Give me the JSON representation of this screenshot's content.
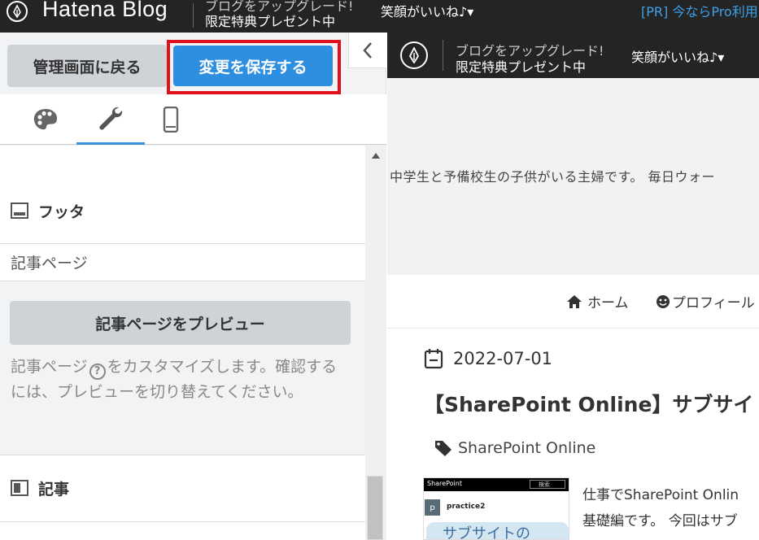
{
  "topbar": {
    "logo_text": "Hatena Blog",
    "promo_line1": "ブログをアップグレード!",
    "promo_line2": "限定特典プレゼント中",
    "user": "笑顔がいいね♪▾",
    "pr_link": "[PR] 今ならPro利用"
  },
  "panel": {
    "back_button": "管理画面に戻る",
    "save_button": "変更を保存する",
    "tabs": [
      "design",
      "customize",
      "smartphone"
    ],
    "sections": {
      "footer_label": "フッタ",
      "article_page_label": "記事ページ",
      "preview_button": "記事ページをプレビュー",
      "desc_before": "記事ページ",
      "desc_help_mark": "?",
      "desc_after": "をカスタマイズします。確認するには、プレビューを切り替えてください。",
      "article_label": "記事"
    }
  },
  "preview": {
    "promo_line1": "ブログをアップグレード!",
    "promo_line2": "限定特典プレゼント中",
    "user": "笑顔がいいね♪▾",
    "blog_description": "中学生と予備校生の子供がいる主婦です。 毎日ウォー",
    "nav_home": "ホーム",
    "nav_profile": "プロフィール",
    "date": "2022-07-01",
    "title": "【SharePoint Online】サブサイト",
    "category": "SharePoint Online",
    "thumb": {
      "bar_title": "SharePoint",
      "search": "検索",
      "site_letter": "p",
      "site_name": "practice2",
      "big_text": "サブサイトの"
    },
    "excerpt_line1": "仕事でSharePoint Onlin",
    "excerpt_line2": "基礎編です。 今回はサブ"
  },
  "colors": {
    "save_blue": "#2e8fe0",
    "highlight_red": "#e0111b",
    "topbar_bg": "#242424",
    "pr_blue": "#3da0e8"
  }
}
